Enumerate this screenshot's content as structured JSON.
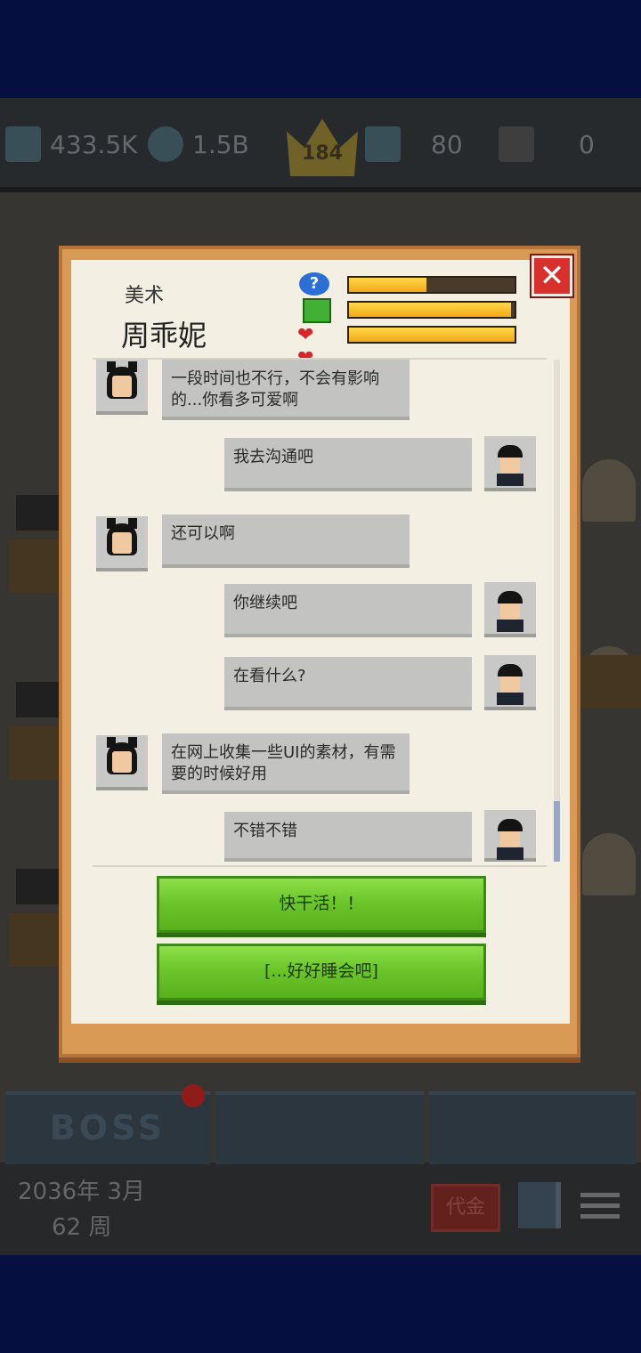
{
  "topbar": {
    "money": "433.5K",
    "funds": "1.5B",
    "level": "184",
    "staff": "80",
    "other": "0"
  },
  "bottom": {
    "date_line1": "2036年 3月",
    "date_line2": "62 周",
    "tab_boss": "BOSS",
    "badge": "代金"
  },
  "dialog": {
    "department": "美术",
    "employee_name": "周乖妮",
    "stats": {
      "skill_pct": 47,
      "mood_pct": 98,
      "affection_pct": 100
    },
    "close_symbol": "✕",
    "messages": [
      {
        "side": "left",
        "text": "一段时间也不行，不会有影响的...你看多可爱啊"
      },
      {
        "side": "right",
        "text": "我去沟通吧"
      },
      {
        "side": "left",
        "text": "还可以啊"
      },
      {
        "side": "right",
        "text": "你继续吧"
      },
      {
        "side": "right",
        "text": "在看什么?"
      },
      {
        "side": "left",
        "text": "在网上收集一些UI的素材，有需要的时候好用"
      },
      {
        "side": "right",
        "text": "不错不错"
      }
    ],
    "buttons": {
      "work": "快干活！！",
      "sleep": "[...好好睡会吧]"
    }
  },
  "icons": {
    "skill": "question-bubble-icon",
    "mood": "smiley-face-icon",
    "affection": "hearts-icon",
    "close": "close-icon"
  },
  "colors": {
    "accent_green": "#6cc62a",
    "frame_orange": "#d89a55",
    "close_red": "#d8302c"
  }
}
